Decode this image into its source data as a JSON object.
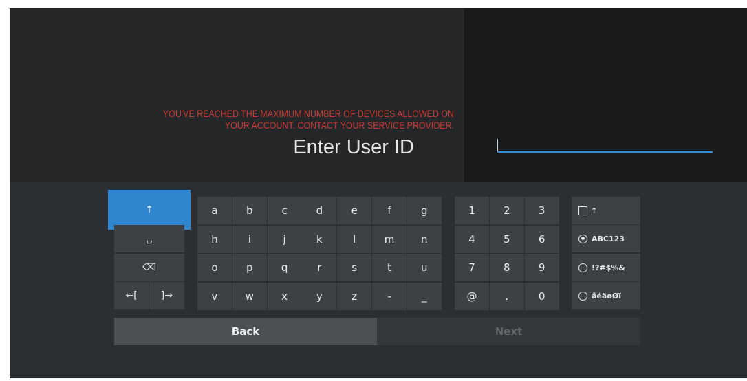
{
  "message": {
    "error_line1": "YOU'VE REACHED THE MAXIMUM NUMBER OF DEVICES ALLOWED ON",
    "error_line2": "YOUR ACCOUNT. CONTACT YOUR SERVICE PROVIDER.",
    "prompt": "Enter User ID"
  },
  "input": {
    "value": ""
  },
  "keyboard": {
    "function_keys": {
      "shift": "↑",
      "space": "␣",
      "backspace": "⌫",
      "cursor_left": "←[",
      "cursor_right": "]→"
    },
    "letters": [
      [
        "a",
        "b",
        "c",
        "d",
        "e",
        "f",
        "g"
      ],
      [
        "h",
        "i",
        "j",
        "k",
        "l",
        "m",
        "n"
      ],
      [
        "o",
        "p",
        "q",
        "r",
        "s",
        "t",
        "u"
      ],
      [
        "v",
        "w",
        "x",
        "y",
        "z",
        "-",
        "_"
      ]
    ],
    "digits": [
      [
        "1",
        "2",
        "3"
      ],
      [
        "4",
        "5",
        "6"
      ],
      [
        "7",
        "8",
        "9"
      ],
      [
        "@",
        ".",
        "0"
      ]
    ],
    "modes": {
      "caps_label": "↑",
      "abc123": "ABC123",
      "symbols": "!?#$%&",
      "accents": "âéäøØï"
    }
  },
  "buttons": {
    "back": "Back",
    "next": "Next"
  },
  "colors": {
    "accent": "#2f86cf",
    "error": "#cc3a34"
  }
}
